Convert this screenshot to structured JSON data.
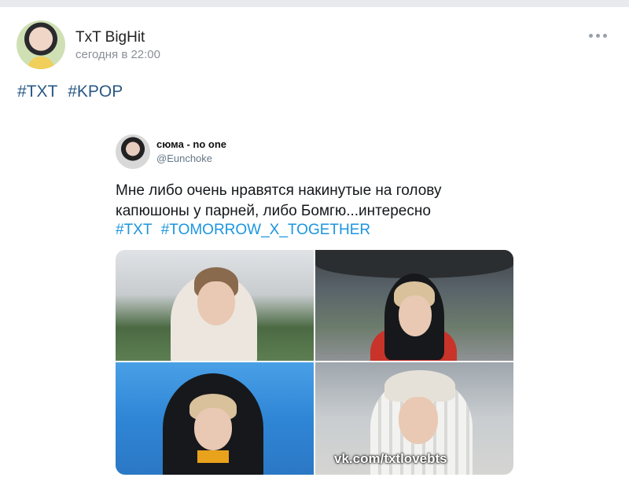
{
  "post": {
    "author": "TxT BigHit",
    "time": "сегодня в 22:00",
    "hashtags": [
      "#TXT",
      "#KPOP"
    ]
  },
  "tweet": {
    "name": "сюма - no one",
    "handle": "@Eunchoke",
    "text_lines": [
      "Мне либо очень нравятся накинутые на голову",
      "капюшоны у парней, либо Бомгю...интересно"
    ],
    "hashtags": [
      "#TXT",
      "#TOMORROW_X_TOGETHER"
    ],
    "watermark": "vk.com/txtlovebts"
  },
  "icons": {
    "more": "more-horizontal-icon"
  },
  "colors": {
    "vk_link": "#2a5885",
    "twitter_link": "#1b95e0",
    "muted": "#8a8f96"
  }
}
